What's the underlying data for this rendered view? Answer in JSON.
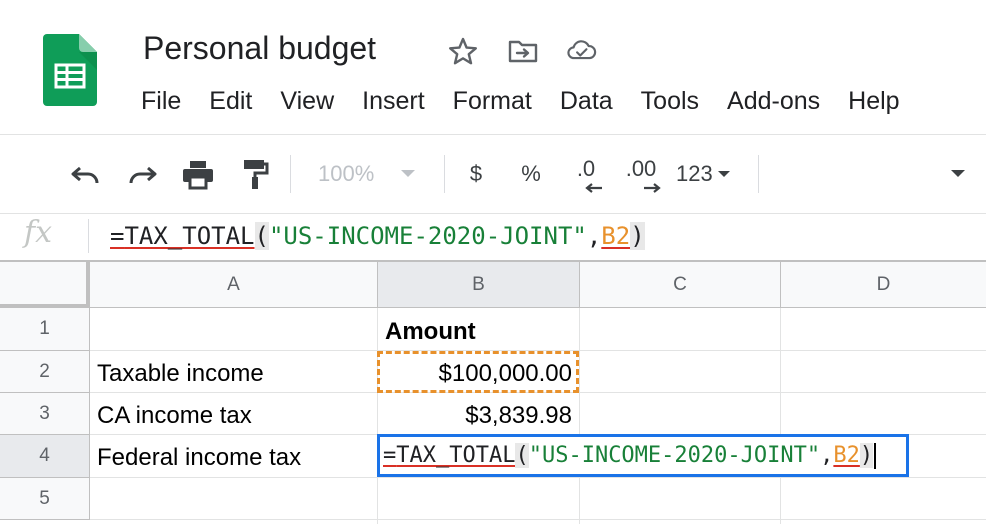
{
  "app": {
    "title": "Personal budget",
    "icons": [
      "sheets-logo-icon",
      "star-icon",
      "move-to-folder-icon",
      "cloud-saved-icon"
    ]
  },
  "menu": [
    "File",
    "Edit",
    "View",
    "Insert",
    "Format",
    "Data",
    "Tools",
    "Add-ons",
    "Help"
  ],
  "toolbar": {
    "zoom": "100%",
    "currency": "$",
    "percent": "%",
    "decrease_decimals": ".0",
    "increase_decimals": ".00",
    "more_formats": "123",
    "icons": [
      "undo-icon",
      "redo-icon",
      "print-icon",
      "paint-format-icon",
      "zoom-dropdown-icon",
      "more-formats-dropdown-icon",
      "toolbar-overflow-dropdown-icon"
    ]
  },
  "formula_bar": {
    "label": "fx",
    "formula": {
      "eq": "=",
      "fn": "TAX_TOTAL",
      "open": "(",
      "arg1": "\"US-INCOME-2020-JOINT\"",
      "comma": ",",
      "arg2": "B2",
      "close": ")"
    }
  },
  "sheet": {
    "columns": [
      "A",
      "B",
      "C",
      "D"
    ],
    "rows": [
      "1",
      "2",
      "3",
      "4",
      "5"
    ],
    "cells": {
      "B1": "Amount",
      "A2": "Taxable income",
      "B2": "$100,000.00",
      "A3": "CA income tax",
      "B3": "$3,839.98",
      "A4": "Federal income tax"
    },
    "active_cell": "B4"
  },
  "colors": {
    "brand_green": "#0f9d58",
    "selection_blue": "#1a73e8",
    "reference_orange": "#e8912c",
    "string_green": "#188038",
    "error_underline": "#d93025"
  }
}
